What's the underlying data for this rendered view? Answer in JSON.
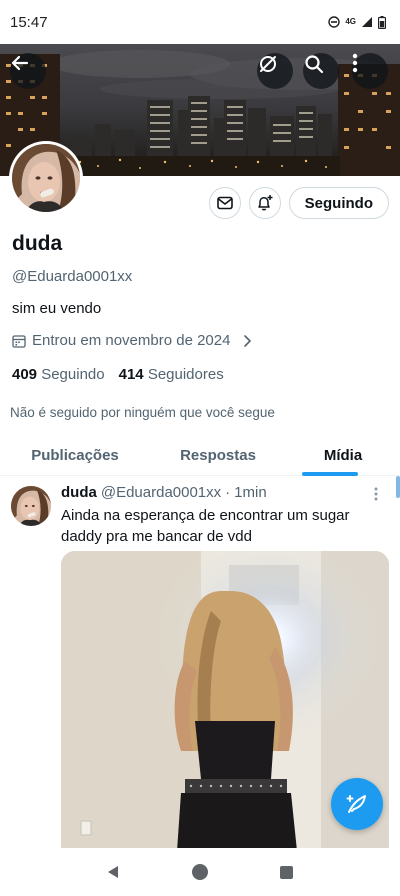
{
  "status_bar": {
    "time": "15:47",
    "network": "4G",
    "icons": [
      "do-not-disturb-icon",
      "network-4g-icon",
      "signal-icon",
      "battery-icon"
    ]
  },
  "banner": {
    "icons": [
      "back-arrow-icon",
      "hide-icon",
      "search-icon",
      "more-vertical-icon"
    ]
  },
  "profile": {
    "name": "duda",
    "handle": "@Eduarda0001xx",
    "bio": "sim eu vendo",
    "joined": "Entrou em novembro de 2024",
    "following_count": "409",
    "following_label": "Seguindo",
    "followers_count": "414",
    "followers_label": "Seguidores",
    "followers_note": "Não é seguido por ninguém que você segue",
    "follow_button": "Seguindo"
  },
  "tabs": [
    {
      "label": "Publicações",
      "active": false
    },
    {
      "label": "Respostas",
      "active": false
    },
    {
      "label": "Mídia",
      "active": true
    }
  ],
  "tweet": {
    "name": "duda",
    "handle": "@Eduarda0001xx",
    "separator": "·",
    "time": "1min",
    "text": "Ainda na esperança de encontrar um sugar daddy pra me bancar de vdd"
  },
  "colors": {
    "accent": "#1d9bf0",
    "text_primary": "#0f1419",
    "text_secondary": "#536471",
    "border": "#cfd9de"
  }
}
